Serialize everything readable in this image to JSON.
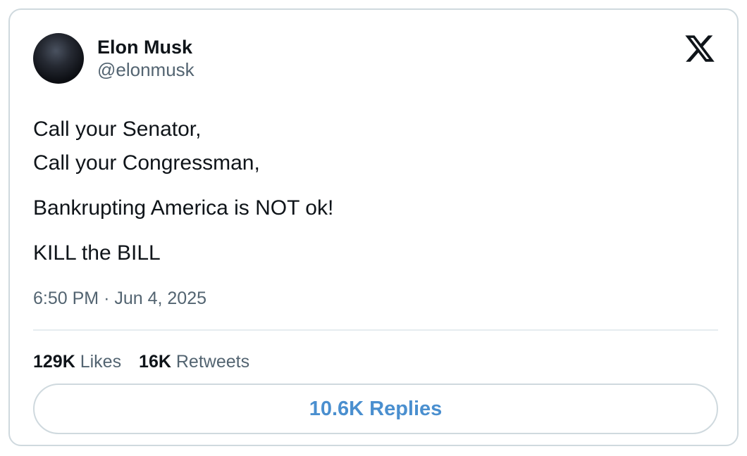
{
  "author": {
    "name": "Elon Musk",
    "handle": "@elonmusk"
  },
  "logo_icon": "x-logo-icon",
  "tweet": {
    "lines": [
      "Call your Senator,",
      "Call your Congressman,",
      "Bankrupting America is NOT ok!",
      "KILL the BILL"
    ],
    "time": "6:50 PM",
    "separator": "·",
    "date": "Jun 4, 2025"
  },
  "stats": {
    "likes_count": "129K",
    "likes_label": "Likes",
    "retweets_count": "16K",
    "retweets_label": "Retweets"
  },
  "replies_button": {
    "label": "10.6K Replies"
  },
  "colors": {
    "text": "#0f1419",
    "secondary": "#536471",
    "accent": "#4a8fcf",
    "border": "#cfd9de"
  }
}
